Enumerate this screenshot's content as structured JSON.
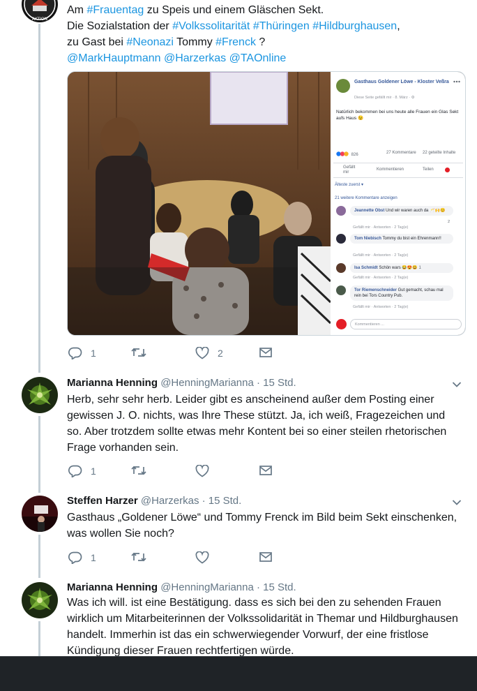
{
  "tweets": [
    {
      "text_parts": [
        {
          "t": "Am ",
          "tag": false
        },
        {
          "t": "#Frauentag",
          "tag": true
        },
        {
          "t": " zu Speis und einem Gläschen Sekt.\nDie Sozialstation der ",
          "tag": false
        },
        {
          "t": "#Volkssolitarität",
          "tag": true
        },
        {
          "t": " ",
          "tag": false
        },
        {
          "t": "#Thüringen",
          "tag": true
        },
        {
          "t": " ",
          "tag": false
        },
        {
          "t": "#Hildburghausen",
          "tag": true
        },
        {
          "t": ",\nzu Gast bei ",
          "tag": false
        },
        {
          "t": "#Neonazi",
          "tag": true
        },
        {
          "t": " Tommy ",
          "tag": false
        },
        {
          "t": "#Frenck",
          "tag": true
        },
        {
          "t": " ?\n",
          "tag": false
        },
        {
          "t": "@MarkHauptmann",
          "tag": true
        },
        {
          "t": " ",
          "tag": false
        },
        {
          "t": "@Harzerkas",
          "tag": true
        },
        {
          "t": " ",
          "tag": false
        },
        {
          "t": "@TAOnline",
          "tag": true
        }
      ],
      "actions": {
        "reply_count": "1",
        "like_count": "2"
      }
    },
    {
      "name": "Marianna Henning",
      "handle": "@HenningMarianna",
      "time": "· 15 Std.",
      "text": "Herb, sehr sehr herb. Leider gibt es anscheinend außer dem Posting einer gewissen J. O. nichts, was Ihre These stützt. Ja, ich weiß, Fragezeichen und so. Aber trotzdem sollte etwas mehr Kontent bei so einer steilen rhetorischen Frage vorhanden sein.",
      "actions": {
        "reply_count": "1"
      }
    },
    {
      "name": "Steffen Harzer",
      "handle": "@Harzerkas",
      "time": "· 15 Std.",
      "text": "Gasthaus „Goldener Löwe“ und Tommy Frenck im Bild beim Sekt einschenken, was wollen Sie noch?",
      "actions": {
        "reply_count": "1"
      }
    },
    {
      "name": "Marianna Henning",
      "handle": "@HenningMarianna",
      "time": "· 15 Std.",
      "text": "Was ich will. ist eine Bestätigung. dass es sich bei den zu sehenden Frauen wirklich um Mitarbeiterinnen der Volkssolidarität in Themar und Hildburghausen handelt. Immerhin ist das ein schwerwiegender Vorwurf, der eine fristlose Kündigung dieser Frauen rechtfertigen würde."
    }
  ],
  "fb_post": {
    "page_name": "Gasthaus Goldener Löwe - Kloster Veßra",
    "subline": "Diese Seite gefällt mir · 8. März · ⚙",
    "text": "Natürlich bekommen bei uns heute alle Frauen ein Glas Sekt aufs Haus 😉",
    "reactions": "826",
    "comments_count": "27 Kommentare",
    "shares_count": "22 geteilte Inhalte",
    "btn_like": "Gefällt mir",
    "btn_comment": "Kommentieren",
    "btn_share": "Teilen",
    "sort": "Älteste zuerst ▾",
    "more_comments": "21 weitere Kommentare anzeigen",
    "comments": [
      {
        "author": "Jeannette Obst",
        "text": "Und wir waren auch da 🥂🙌😊",
        "footer": "Gefällt mir · Antworten · 2 Tag(e)",
        "badge": "2"
      },
      {
        "author": "Tom Niebisch",
        "text": "Tommy du bist ein Ehrenmann!!",
        "footer": "Gefällt mir · Antworten · 2 Tag(e)"
      },
      {
        "author": "Isa Schmidt",
        "text": "Schön wars 😂😍😃",
        "footer": "Gefällt mir · Antworten · 2 Tag(e)",
        "badge": "1"
      },
      {
        "author": "Tor Riemenschneider",
        "text": "Gut gemacht, schau mal rein bei Tors Country Pub.",
        "footer": "Gefällt mir · Antworten · 2 Tag(e)"
      }
    ],
    "comment_placeholder": "Kommentieren ..."
  },
  "colors": {
    "link": "#1b95e0",
    "muted": "#657786",
    "thread_line": "#c4cfd6",
    "fb_link": "#365899"
  },
  "icons": [
    "reply-icon",
    "retweet-icon",
    "like-icon",
    "dm-icon",
    "chevron-down-icon"
  ]
}
